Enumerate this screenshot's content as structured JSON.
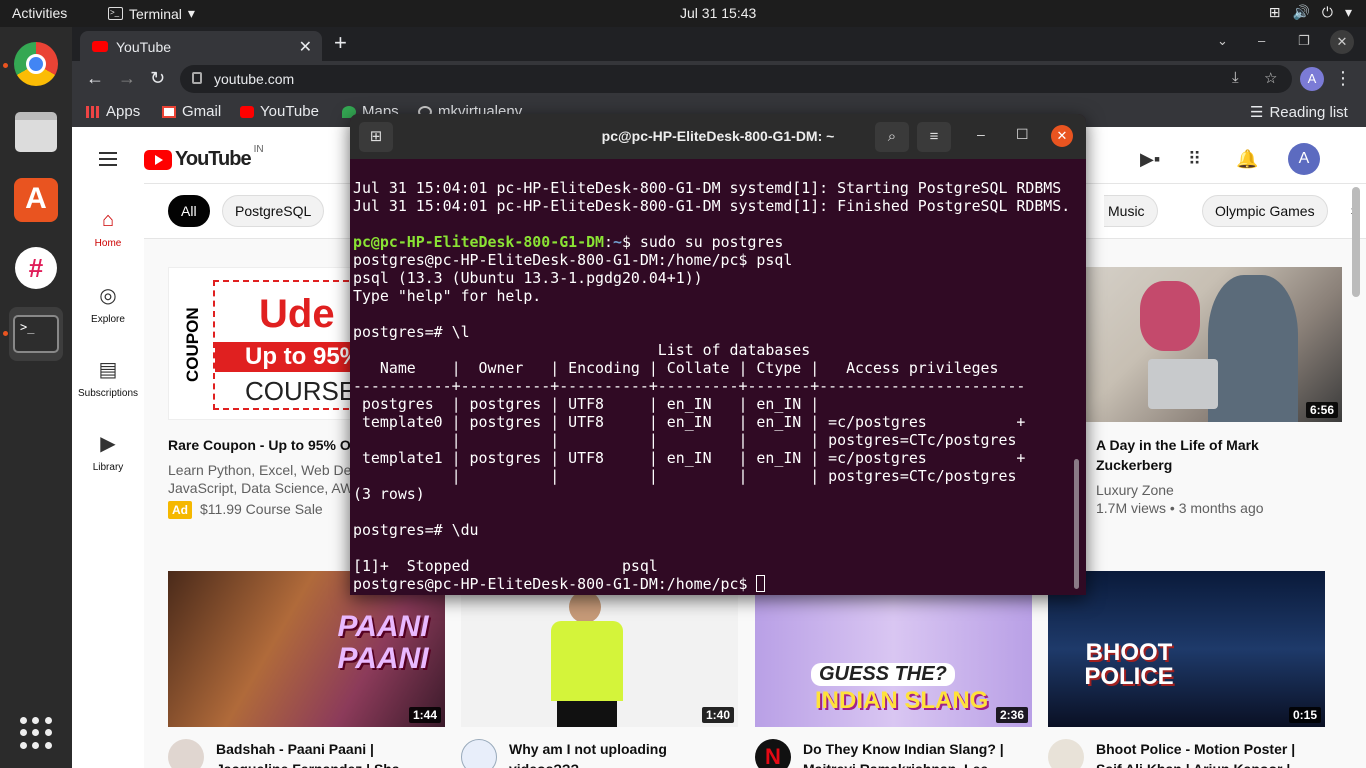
{
  "topbar": {
    "activities": "Activities",
    "app_name": "Terminal",
    "clock": "Jul 31  15:43"
  },
  "dock": {
    "items": [
      "Google Chrome",
      "Files",
      "Ubuntu Software",
      "Slack",
      "Terminal"
    ]
  },
  "chrome": {
    "tab_title": "YouTube",
    "url": "youtube.com",
    "profile_initial": "A",
    "bookmarks": [
      "Apps",
      "Gmail",
      "YouTube",
      "Maps",
      "mkvirtualenv"
    ],
    "reading_list": "Reading list"
  },
  "youtube": {
    "logo_text": "YouTube",
    "country_code": "IN",
    "avatar_initial": "A",
    "guide": [
      {
        "label": "Home"
      },
      {
        "label": "Explore"
      },
      {
        "label": "Subscriptions"
      },
      {
        "label": "Library"
      }
    ],
    "chips": [
      "All",
      "PostgreSQL",
      "Music",
      "Olympic Games"
    ],
    "videos_row1": [
      {
        "title": "Rare Coupon - Up to 95% Off",
        "meta1": "Learn Python, Excel, Web Dev",
        "meta2": "JavaScript, Data Science, AWS",
        "ad_badge": "Ad",
        "price": "$11.99 Course Sale",
        "thumb_text_1": "Ude",
        "thumb_text_2": "Up to 95%",
        "thumb_text_3": "COURSE",
        "thumb_side": "COUPON"
      },
      {
        "title": "A Day in the Life of Mark Zuckerberg",
        "channel": "Luxury Zone",
        "stats": "1.7M views • 3 months ago",
        "duration": "6:56"
      }
    ],
    "videos_row2": [
      {
        "title": "Badshah - Paani Paani |",
        "title2": "Jacqueline Fernandez | Sha",
        "duration": "1:44",
        "thumb_text": "PAANI PAANI"
      },
      {
        "title": "Why am I not uploading",
        "title2": "videos???",
        "duration": "1:40"
      },
      {
        "title": "Do They Know Indian Slang? |",
        "title2": "Maitreyi Ramakrishnan, Lee",
        "duration": "2:36",
        "thumb_text_1": "GUESS THE?",
        "thumb_text_2": "INDIAN SLANG"
      },
      {
        "title": "Bhoot Police - Motion Poster |",
        "title2": "Saif Ali Khan | Arjun Kapoor |",
        "duration": "0:15",
        "thumb_text": "BHOOT POLICE"
      }
    ]
  },
  "terminal": {
    "title": "pc@pc-HP-EliteDesk-800-G1-DM: ~",
    "lines": [
      {
        "text": "Jul 31 15:04:01 pc-HP-EliteDesk-800-G1-DM systemd[1]: Starting PostgreSQL RDBMS"
      },
      {
        "text": "Jul 31 15:04:01 pc-HP-EliteDesk-800-G1-DM systemd[1]: Finished PostgreSQL RDBMS."
      },
      {
        "text": ""
      },
      {
        "user": "pc@pc-HP-EliteDesk-800-G1-DM",
        "path": "~",
        "cmd": "$ sudo su postgres"
      },
      {
        "text": "postgres@pc-HP-EliteDesk-800-G1-DM:/home/pc$ psql"
      },
      {
        "text": "psql (13.3 (Ubuntu 13.3-1.pgdg20.04+1))"
      },
      {
        "text": "Type \"help\" for help."
      },
      {
        "text": ""
      },
      {
        "text": "postgres=# \\l"
      },
      {
        "text": "                                  List of databases"
      },
      {
        "text": "   Name    |  Owner   | Encoding | Collate | Ctype |   Access privileges"
      },
      {
        "text": "-----------+----------+----------+---------+-------+-----------------------"
      },
      {
        "text": " postgres  | postgres | UTF8     | en_IN   | en_IN |"
      },
      {
        "text": " template0 | postgres | UTF8     | en_IN   | en_IN | =c/postgres          +"
      },
      {
        "text": "           |          |          |         |       | postgres=CTc/postgres"
      },
      {
        "text": " template1 | postgres | UTF8     | en_IN   | en_IN | =c/postgres          +"
      },
      {
        "text": "           |          |          |         |       | postgres=CTc/postgres"
      },
      {
        "text": "(3 rows)"
      },
      {
        "text": ""
      },
      {
        "text": "postgres=# \\du"
      },
      {
        "text": ""
      },
      {
        "text": "[1]+  Stopped                 psql"
      },
      {
        "text": "postgres@pc-HP-EliteDesk-800-G1-DM:/home/pc$ ",
        "cursor": true
      }
    ]
  }
}
